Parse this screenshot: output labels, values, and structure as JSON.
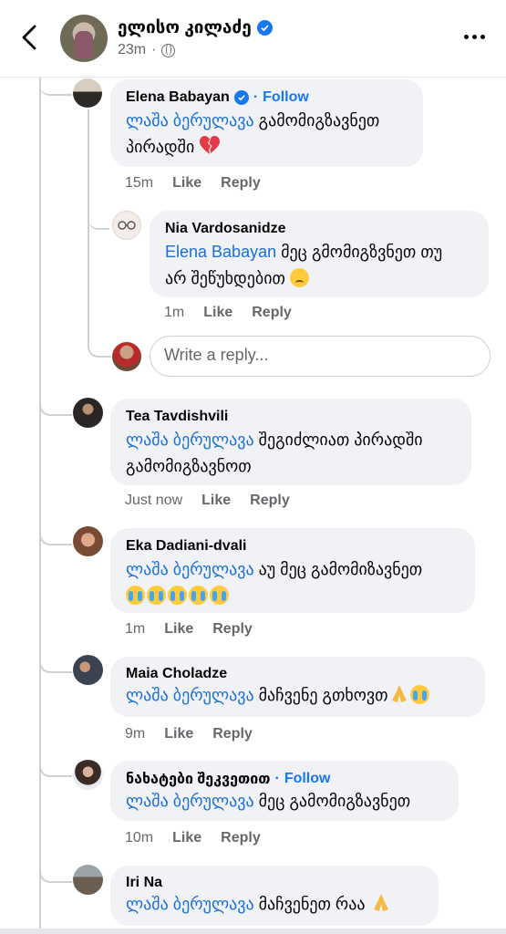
{
  "header": {
    "author": "ელისო კილაძე",
    "time": "23m",
    "separator": "·"
  },
  "comments": [
    {
      "name": "Elena Babayan",
      "follow": "Follow",
      "mention": "ლაშა ბერულავა",
      "text1": " გამომიგზავნეთ",
      "text2": "პირადში ",
      "time": "15m",
      "like": "Like",
      "reply": "Reply"
    },
    {
      "name": "Nia Vardosanidze",
      "mention": "Elena Babayan",
      "text1": " მეც გმომიგზვნეთ თუ",
      "text2": "არ შეწუხდებით ",
      "time": "1m",
      "like": "Like",
      "reply": "Reply"
    },
    {
      "name": "Tea Tavdishvili",
      "mention": "ლაშა ბერულავა",
      "text1": " შეგიძლიათ პირადში",
      "text2": "გამომიგზავნოთ",
      "time": "Just now",
      "like": "Like",
      "reply": "Reply"
    },
    {
      "name": "Eka Dadiani-dvali",
      "mention": "ლაშა ბერულავა",
      "text1": " აუ მეც გამომიზავნეთ",
      "time": "1m",
      "like": "Like",
      "reply": "Reply"
    },
    {
      "name": "Maia Choladze",
      "mention": "ლაშა ბერულავა",
      "text1": " მაჩვენე გთხოვთ",
      "time": "9m",
      "like": "Like",
      "reply": "Reply"
    },
    {
      "name": "ნახატები შეკვეთით",
      "follow": "Follow",
      "mention": "ლაშა ბერულავა",
      "text1": " მეც გამომიგზავნეთ",
      "time": "10m",
      "like": "Like",
      "reply": "Reply"
    },
    {
      "name": "Iri Na",
      "mention": "ლაშა ბერულავა",
      "text1": " მაჩვენეთ რაა "
    }
  ],
  "reply_input": {
    "placeholder": "Write a reply..."
  },
  "icons": [
    "back-arrow-icon",
    "verified-badge-icon",
    "globe-icon",
    "more-options-icon",
    "broken-heart-emoji",
    "sad-emoji",
    "crying-emoji",
    "pray-emoji"
  ],
  "colors": {
    "accent": "#1877f2",
    "bubble": "#f0f2f5",
    "secondary_text": "#65676b"
  }
}
